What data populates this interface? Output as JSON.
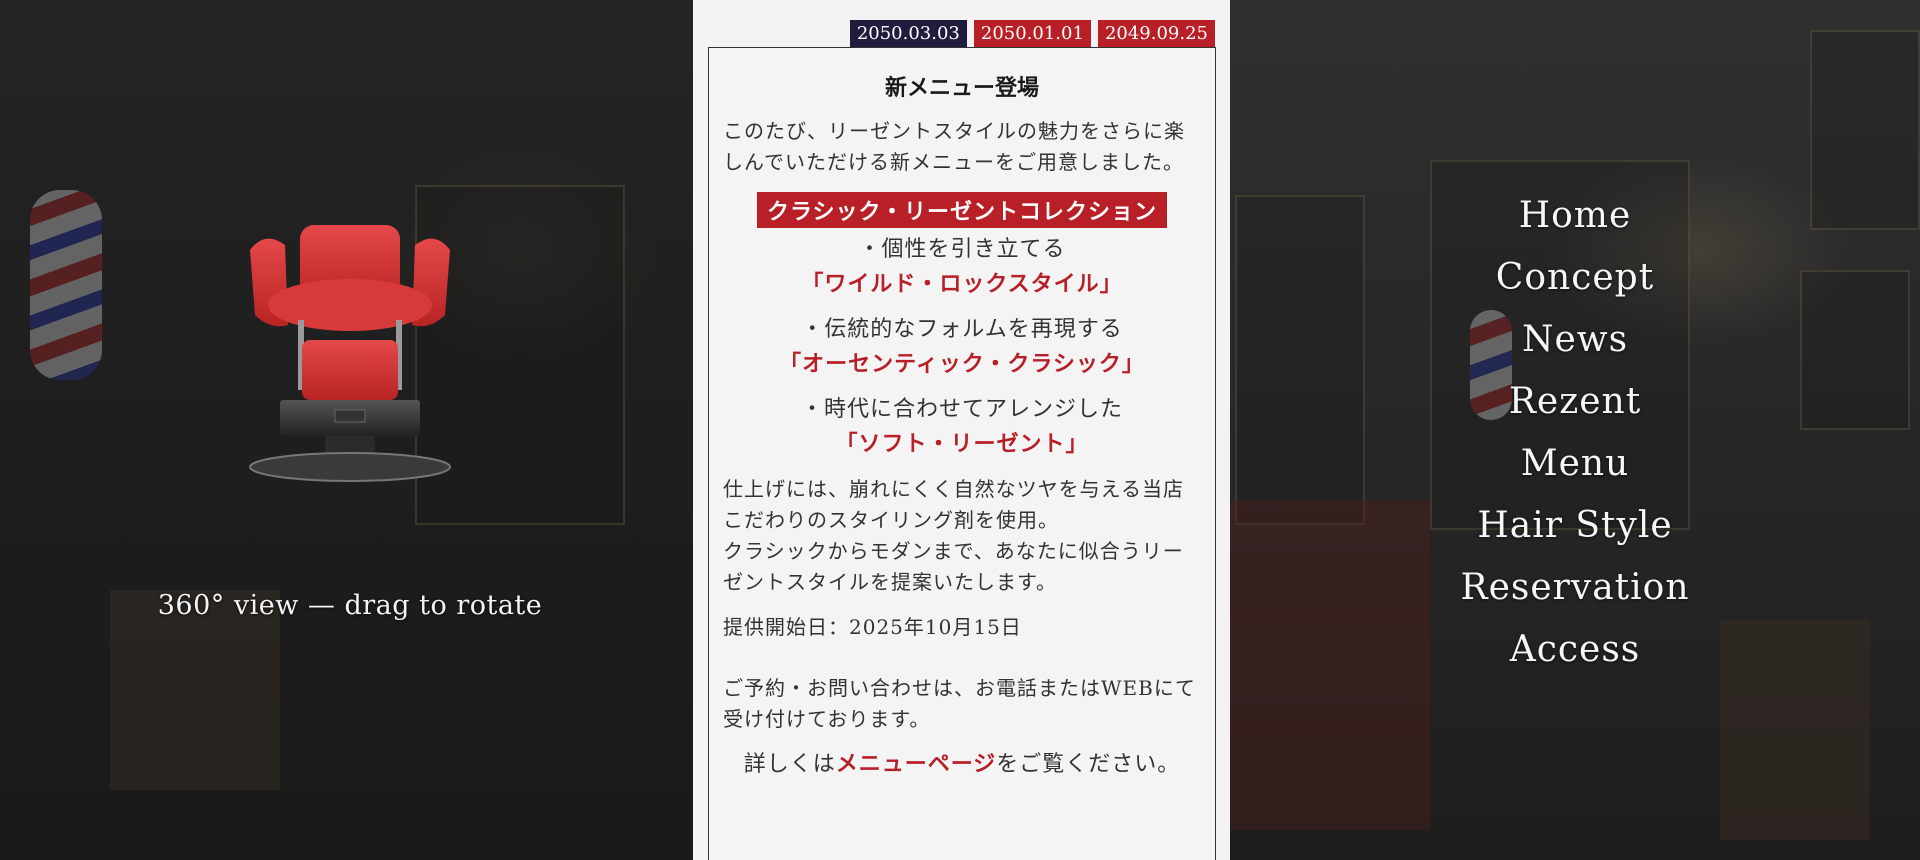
{
  "viewer": {
    "label": "360° view — drag to rotate",
    "chair_color": "#d83a3a"
  },
  "news": {
    "dates": [
      "2050.03.03",
      "2050.01.01",
      "2049.09.25"
    ],
    "active_date": "2050.03.03",
    "title": "新メニュー登場",
    "intro": "このたび、リーゼントスタイルの魅力をさらに楽しんでいただける新メニューをご用意しました。",
    "collection": "クラシック・リーゼントコレクション",
    "styles": [
      {
        "desc": "・個性を引き立てる",
        "name": "「ワイルド・ロックスタイル」"
      },
      {
        "desc": "・伝統的なフォルムを再現する",
        "name": "「オーセンティック・クラシック」"
      },
      {
        "desc": "・時代に合わせてアレンジした",
        "name": "「ソフト・リーゼント」"
      }
    ],
    "body1": "仕上げには、崩れにくく自然なツヤを与える当店こだわりのスタイリング剤を使用。",
    "body2": "クラシックからモダンまで、あなたに似合うリーゼントスタイルを提案いたします。",
    "start_date": "提供開始日：2025年10月15日",
    "contact": "ご予約・お問い合わせは、お電話またはWEBにて受け付けております。",
    "detail_prefix": "詳しくは",
    "detail_link": "メニューページ",
    "detail_suffix": "をご覧ください。"
  },
  "nav": {
    "items": [
      "Home",
      "Concept",
      "News",
      "Rezent",
      "Menu",
      "Hair Style",
      "Reservation",
      "Access"
    ]
  },
  "colors": {
    "accent_red": "#b81f26",
    "active_tab": "#1e1d3d"
  }
}
